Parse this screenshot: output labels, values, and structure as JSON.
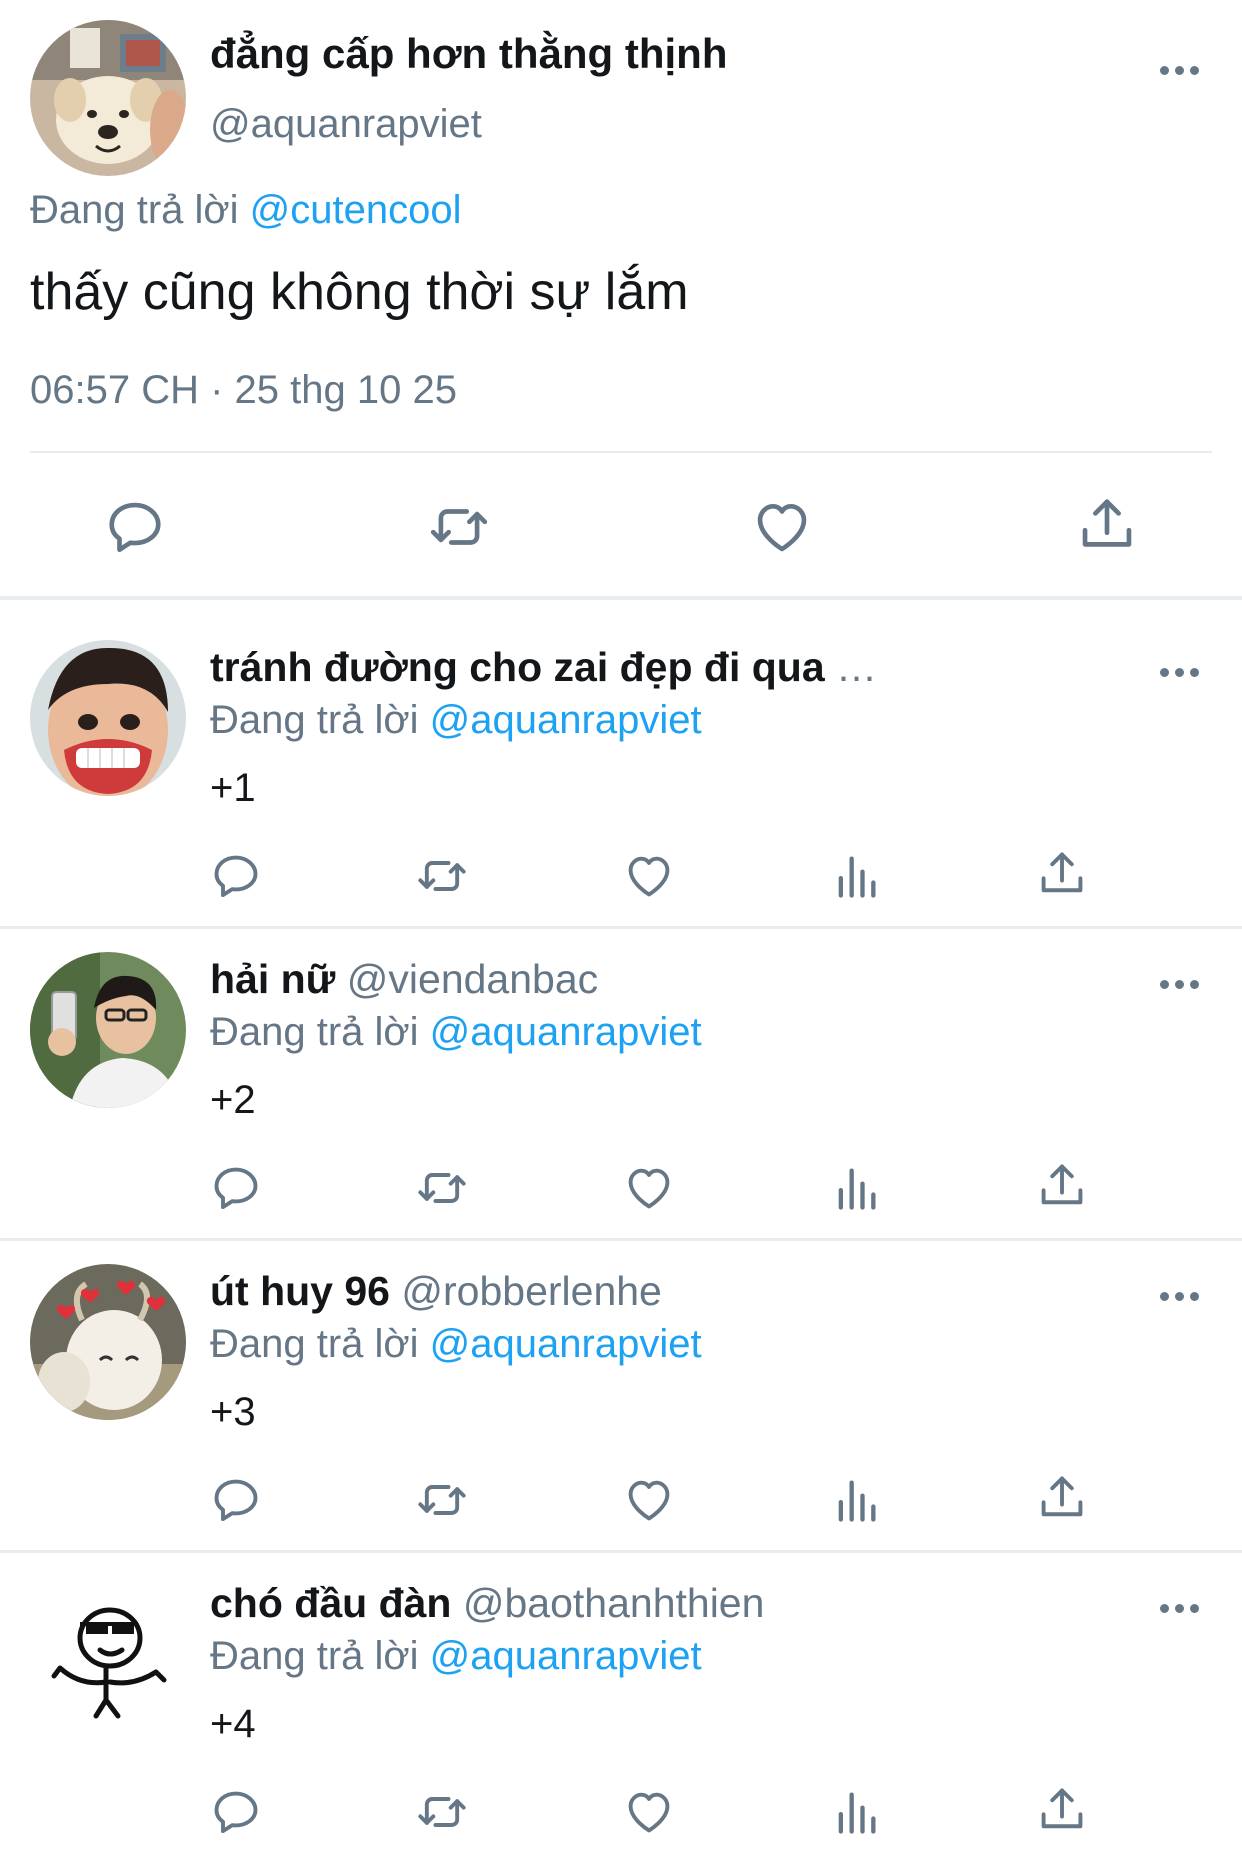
{
  "main_tweet": {
    "display_name": "đẳng cấp hơn thằng thịnh",
    "handle": "@aquanrapviet",
    "replying_label": "Đang trả lời",
    "replying_to": "@cutencool",
    "text": "thấy cũng không thời sự lắm",
    "timestamp": "06:57 CH · 25 thg 10 25",
    "actions": [
      "reply-icon",
      "retweet-icon",
      "like-icon",
      "share-icon"
    ]
  },
  "replies": [
    {
      "display_name": "tránh đường cho zai đẹp đi qua",
      "handle": "…",
      "replying_label": "Đang trả lời",
      "replying_to": "@aquanrapviet",
      "text": "+1"
    },
    {
      "display_name": "hải nữ",
      "handle": "@viendanbac",
      "replying_label": "Đang trả lời",
      "replying_to": "@aquanrapviet",
      "text": "+2"
    },
    {
      "display_name": "út huy 96",
      "handle": "@robberlenhe",
      "replying_label": "Đang trả lời",
      "replying_to": "@aquanrapviet",
      "text": "+3"
    },
    {
      "display_name": "chó đầu đàn",
      "handle": "@baothanhthien",
      "replying_label": "Đang trả lời",
      "replying_to": "@aquanrapviet",
      "text": "+4"
    }
  ],
  "reply_actions": [
    "reply-icon",
    "retweet-icon",
    "like-icon",
    "analytics-icon",
    "share-icon"
  ],
  "colors": {
    "link": "#1da1f2",
    "secondary": "#657786",
    "text": "#14171a",
    "divider": "#e6ecf0"
  }
}
